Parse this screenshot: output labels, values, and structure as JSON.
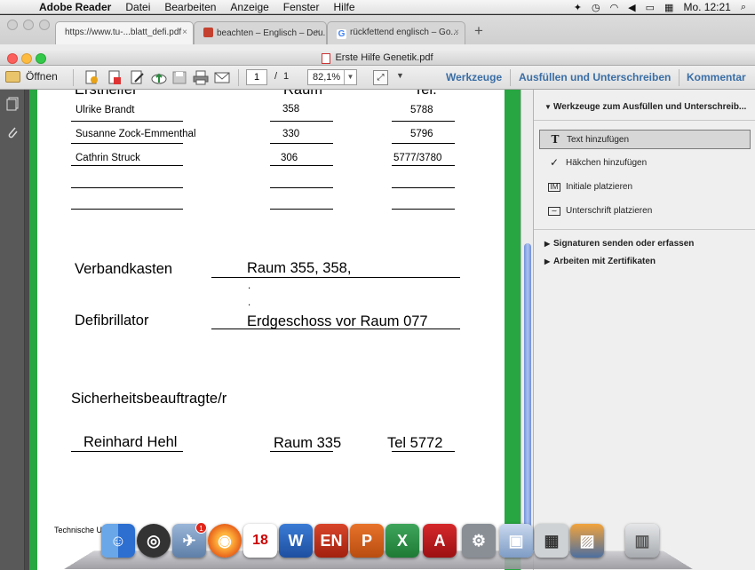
{
  "menubar": {
    "app_name": "Adobe Reader",
    "menus": [
      "Datei",
      "Bearbeiten",
      "Anzeige",
      "Fenster",
      "Hilfe"
    ],
    "clock": "Mo. 12:21"
  },
  "browser": {
    "tabs": [
      {
        "title": "https://www.tu-...blatt_defi.pdf",
        "active": true
      },
      {
        "title": "beachten – Englisch – Deu...",
        "active": false
      },
      {
        "title": "rückfettend englisch – Go...",
        "active": false
      }
    ]
  },
  "window": {
    "title": "Erste Hilfe Genetik.pdf"
  },
  "toolbar": {
    "open_label": "Öffnen",
    "page_current": "1",
    "page_sep": "/",
    "page_total": "1",
    "zoom": "82,1%",
    "tab_tools": "Werkzeuge",
    "tab_fill_sign": "Ausfüllen und Unterschreiben",
    "tab_comment": "Kommentar"
  },
  "document": {
    "partial_headers": [
      "Ersthelfer",
      "Raum",
      "Tel."
    ],
    "helpers": [
      {
        "name": "Ulrike Brandt",
        "room": "358",
        "tel": "5788"
      },
      {
        "name": "Susanne Zock-Emmenthal",
        "room": "330",
        "tel": "5796"
      },
      {
        "name": "Cathrin Struck",
        "room": "306",
        "tel": "5777/3780"
      }
    ],
    "verbandkasten_label": "Verbandkasten",
    "verbandkasten_value": "Raum 355, 358,",
    "dot1": ".",
    "dot2": ".",
    "defi_label": "Defibrillator",
    "defi_value": "Erdgeschoss vor Raum 077",
    "safety_label": "Sicherheitsbeauftragte/r",
    "safety_name": "Reinhard Hehl",
    "safety_room": "Raum 335",
    "safety_tel": "Tel 5772",
    "footer_fragment": "Technische U"
  },
  "right_panel": {
    "section_title": "Werkzeuge zum Ausfüllen und Unterschreib...",
    "items": [
      {
        "label": "Text hinzufügen",
        "icon": "text-T-icon"
      },
      {
        "label": "Häkchen hinzufügen",
        "icon": "checkmark-icon"
      },
      {
        "label": "Initiale platzieren",
        "icon": "initials-icon"
      },
      {
        "label": "Unterschrift platzieren",
        "icon": "signature-icon"
      }
    ],
    "sections": [
      "Signaturen senden oder erfassen",
      "Arbeiten mit Zertifikaten"
    ]
  },
  "dock": {
    "calendar_day": "18",
    "badge_count": "1"
  }
}
